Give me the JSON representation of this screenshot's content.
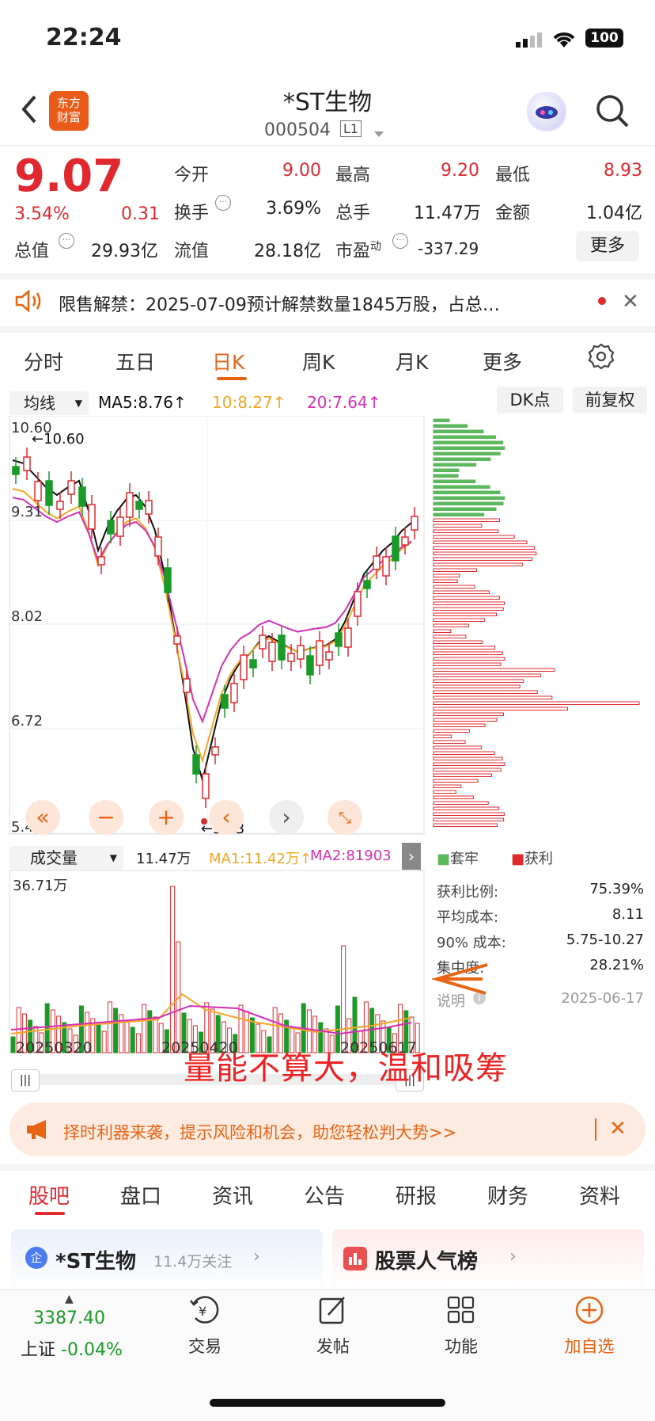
{
  "status_bar": {
    "time": "22:24",
    "battery": "100"
  },
  "header": {
    "logo_text": "东方\n财富",
    "stock_name": "*ST生物",
    "stock_code": "000504",
    "level": "L1"
  },
  "quote": {
    "price": "9.07",
    "change_pct": "3.54%",
    "change_amt": "0.31",
    "open_label": "今开",
    "open": "9.00",
    "high_label": "最高",
    "high": "9.20",
    "low_label": "最低",
    "low": "8.93",
    "turnover_label": "换手",
    "turnover": "3.69%",
    "volume_label": "总手",
    "volume": "11.47万",
    "amount_label": "金额",
    "amount": "1.04亿",
    "mktcap_label": "总值",
    "mktcap": "29.93亿",
    "float_label": "流值",
    "float": "28.18亿",
    "pe_label": "市盈",
    "pe_sup": "动",
    "pe": "-337.29",
    "more_label": "更多"
  },
  "notice": {
    "text": "限售解禁：2025-07-09预计解禁数量1845万股，占总…"
  },
  "chart_tabs": [
    "分时",
    "五日",
    "日K",
    "周K",
    "月K",
    "更多"
  ],
  "ma_bar": {
    "select": "均线",
    "ma5": "MA5:8.76↑",
    "ma10": "10:8.27↑",
    "ma20": "20:7.64↑",
    "dk_label": "DK点",
    "adjust_label": "前复权"
  },
  "kline": {
    "y_labels": [
      "10.60",
      "9.31",
      "8.02",
      "6.72",
      "5.43"
    ],
    "high_marker": "10.60",
    "low_marker": "5.43"
  },
  "volume_bar": {
    "select": "成交量",
    "vol": "11.47万",
    "ma1": "MA1:11.42万↑",
    "ma2": "MA2:81903",
    "max_label": "36.71万"
  },
  "x_labels": [
    "20250320",
    "20250420",
    "20250617"
  ],
  "chip_legend": {
    "trapped": "套牢",
    "profit": "获利"
  },
  "chip_stats": [
    {
      "label": "获利比例:",
      "value": "75.39%"
    },
    {
      "label": "平均成本:",
      "value": "8.11"
    },
    {
      "label": "90% 成本:",
      "value": "5.75-10.27"
    },
    {
      "label": "集中度:",
      "value": "28.21%"
    }
  ],
  "chip_note": {
    "label": "说明",
    "date": "2025-06-17"
  },
  "annotation": "量能不算大，温和吸筹",
  "promo": {
    "text": "择时利器来袭，提示风险和机会，助您轻松判大势>>"
  },
  "bottom_tabs": [
    "股吧",
    "盘口",
    "资讯",
    "公告",
    "研报",
    "财务",
    "资料"
  ],
  "cards": {
    "left_name": "*ST生物",
    "left_sub": "11.4万关注",
    "right_name": "股票人气榜"
  },
  "bottom_nav": {
    "index_value": "3387.40",
    "index_name": "上证",
    "index_change": "-0.04%",
    "trade": "交易",
    "post": "发帖",
    "func": "功能",
    "add": "加自选"
  },
  "colors": {
    "up": "#e0292f",
    "down": "#1a9a28",
    "accent": "#e86413",
    "ma5": "#111111",
    "ma10": "#f5a623",
    "ma20": "#d52fb6"
  }
}
